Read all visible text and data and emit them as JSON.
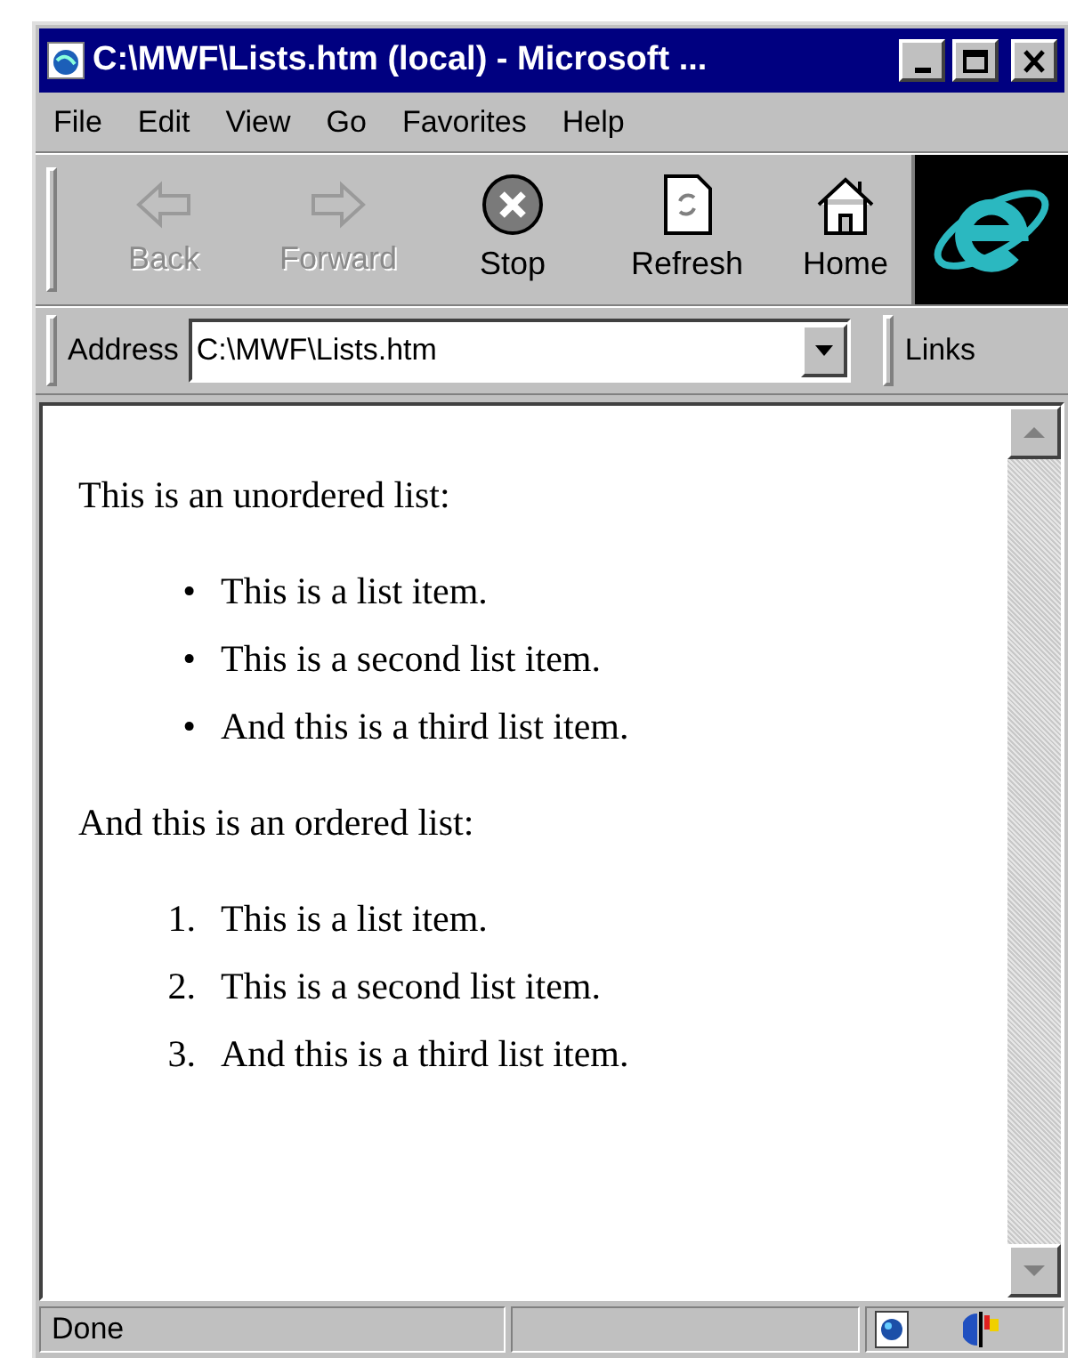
{
  "window": {
    "title": "C:\\MWF\\Lists.htm (local) - Microsoft ..."
  },
  "menu": [
    {
      "label": "File"
    },
    {
      "label": "Edit"
    },
    {
      "label": "View"
    },
    {
      "label": "Go"
    },
    {
      "label": "Favorites"
    },
    {
      "label": "Help"
    }
  ],
  "toolbar": [
    {
      "kind": "back",
      "label": "Back",
      "disabled": true
    },
    {
      "kind": "forward",
      "label": "Forward",
      "disabled": true
    },
    {
      "kind": "stop",
      "label": "Stop",
      "disabled": false
    },
    {
      "kind": "refresh",
      "label": "Refresh",
      "disabled": false
    },
    {
      "kind": "home",
      "label": "Home",
      "disabled": false
    }
  ],
  "address": {
    "label": "Address",
    "value": "C:\\MWF\\Lists.htm",
    "links": "Links"
  },
  "content": [
    {
      "kind": "paragraph",
      "text": "This is an unordered list:"
    },
    {
      "kind": "list",
      "items": [
        {
          "marker": "•",
          "text": "This is a list item."
        },
        {
          "marker": "•",
          "text": "This is a second list item."
        },
        {
          "marker": "•",
          "text": "And this is a third list item."
        }
      ]
    },
    {
      "kind": "paragraph",
      "text": "And this is an ordered list:"
    },
    {
      "kind": "list",
      "items": [
        {
          "marker": "1.",
          "text": "This is a list item."
        },
        {
          "marker": "2.",
          "text": "This is a second list item."
        },
        {
          "marker": "3.",
          "text": "And this is a third list item."
        }
      ]
    }
  ],
  "status_bar": {
    "text": "Done"
  }
}
